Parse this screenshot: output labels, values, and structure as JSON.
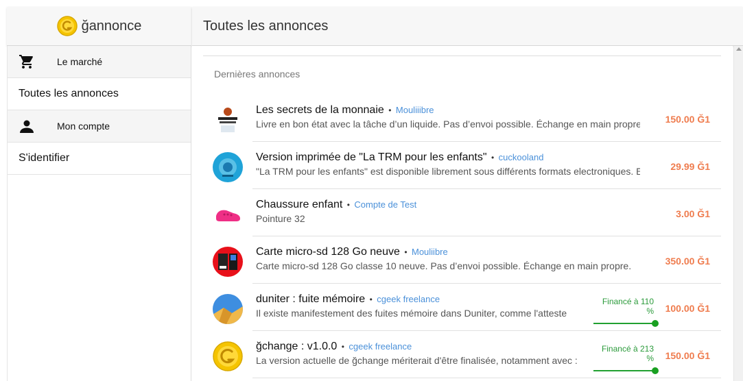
{
  "app": {
    "brand_prefix": "ğ",
    "brand_name": "annonce",
    "page_title": "Toutes les annonces"
  },
  "sidebar": {
    "items": [
      {
        "label": "Le marché",
        "icon": "cart-icon"
      },
      {
        "label": "Toutes les annonces"
      },
      {
        "label": "Mon compte",
        "icon": "person-icon"
      },
      {
        "label": "S'identifier"
      }
    ]
  },
  "main": {
    "section_label": "Dernières annonces",
    "ads": [
      {
        "title": "Les secrets de la monnaie",
        "author": "Mouliiibre",
        "description": "Livre en bon état avec la tâche d’un liquide. Pas d’envoi possible. Échange en main propre.",
        "price": "150.00 Ğ1"
      },
      {
        "title": "Version imprimée de \"La TRM pour les enfants\"",
        "author": "cuckooland",
        "description": "\"La TRM pour les enfants\" est disponible librement sous différents formats electroniques. Elle",
        "price": "29.99 Ğ1"
      },
      {
        "title": "Chaussure enfant",
        "author": "Compte de Test",
        "description": "Pointure 32",
        "price": "3.00 Ğ1"
      },
      {
        "title": "Carte micro-sd 128 Go neuve",
        "author": "Mouliibre",
        "description": "Carte micro-sd 128 Go classe 10 neuve. Pas d’envoi possible. Échange en main propre.",
        "price": "350.00 Ğ1"
      },
      {
        "title": "duniter : fuite mémoire",
        "author": "cgeek freelance",
        "description": "Il existe manifestement des fuites mémoire dans Duniter, comme l'atteste",
        "price": "100.00 Ğ1",
        "funding": "Financé à 110 %"
      },
      {
        "title": "ğchange : v1.0.0",
        "author": "cgeek freelance",
        "description": "La version actuelle de ğchange mériterait d'être finalisée, notamment avec :",
        "price": "150.00 Ğ1",
        "funding": "Financé à 213 %"
      }
    ]
  },
  "colors": {
    "price": "#ef7c4e",
    "author": "#4a90d9",
    "funding": "#20a030",
    "header_bg": "#f7f7f7"
  }
}
